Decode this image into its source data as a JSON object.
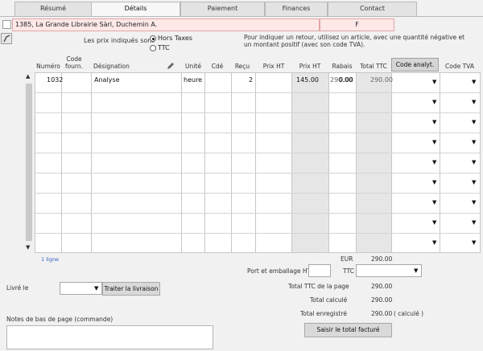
{
  "tabs": [
    {
      "label": "Résumé"
    },
    {
      "label": "Détails"
    },
    {
      "label": "Paiement"
    },
    {
      "label": "Finances"
    },
    {
      "label": "Contact"
    }
  ],
  "client": {
    "name": "1385, La Grande Librairie Sàrl, Duchemin A.",
    "code": "F"
  },
  "prices": {
    "label": "Les prix indiqués sont",
    "option_ht": "Hors Taxes",
    "option_ttc": "TTC",
    "selected": "Hors Taxes",
    "hint": "Pour indiquer un retour, utilisez un article, avec une quantité négative et un montant positif (avec son code TVA)."
  },
  "columns": {
    "numero": "Numéro",
    "code_fourn": "Code fourn.",
    "designation": "Désignation",
    "unite": "Unité",
    "cde": "Cdé",
    "recu": "Reçu",
    "prix_ht": "Prix HT",
    "prix_ht2": "Prix HT",
    "rabais": "Rabais",
    "total_ttc": "Total TTC",
    "code_analyt": "Code analyt.",
    "code_tva": "Code TVA"
  },
  "rows": [
    {
      "numero": "1032",
      "designation": "Analyse",
      "unite": "heure",
      "recu": "2",
      "prix_ht": "145.00",
      "prix_ht2": "290.00",
      "rabais": "0.00",
      "total_ttc": "290.00"
    }
  ],
  "line_count": "1 ligne",
  "totals": {
    "currency": "EUR",
    "currency_total": "290.00",
    "port_label": "Port et emballage HT",
    "ttc_label": "TTC",
    "page_total_label": "Total TTC de la page",
    "page_total": "290.00",
    "calc_label": "Total calculé",
    "calc_value": "290.00",
    "reg_label": "Total enregistré",
    "reg_value": "290.00",
    "reg_note": "( calculé )",
    "set_total_button": "Saisir le total facturé"
  },
  "delivery": {
    "label": "Livré le",
    "button": "Traiter la livraison"
  },
  "notes": {
    "label": "Notes de bas de page (commande)"
  }
}
